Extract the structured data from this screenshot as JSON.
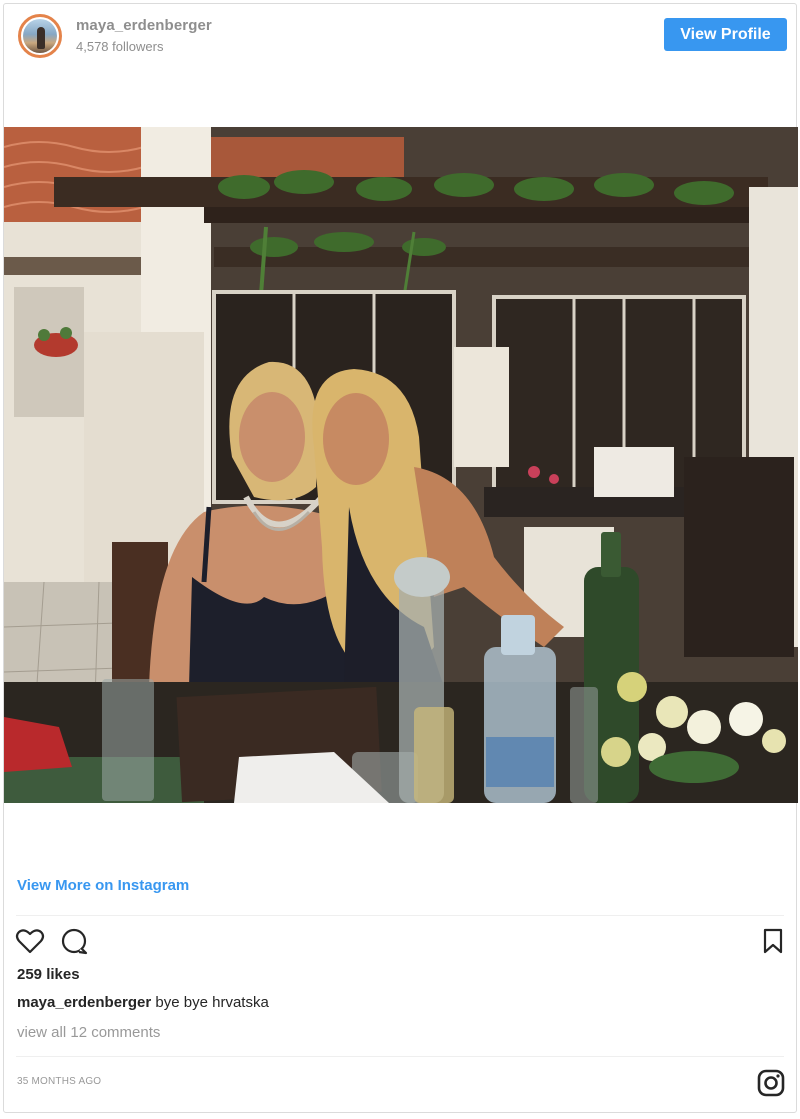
{
  "header": {
    "username": "maya_erdenberger",
    "followers": "4,578 followers",
    "view_profile_label": "View Profile"
  },
  "post": {
    "image_alt": "Instagram post photo",
    "view_more_label": "View More on Instagram",
    "likes": "259 likes",
    "caption_user": "maya_erdenberger",
    "caption_text": "bye bye hrvatska",
    "comments_link": "view all 12 comments",
    "timestamp": "35 MONTHS AGO"
  },
  "icons": {
    "like": "heart-icon",
    "comment": "comment-icon",
    "save": "bookmark-icon",
    "brand": "instagram-logo-icon"
  },
  "colors": {
    "accent": "#3897f0",
    "muted_text": "#8e8e8e",
    "text": "#262626",
    "border": "#dbdbdb"
  }
}
